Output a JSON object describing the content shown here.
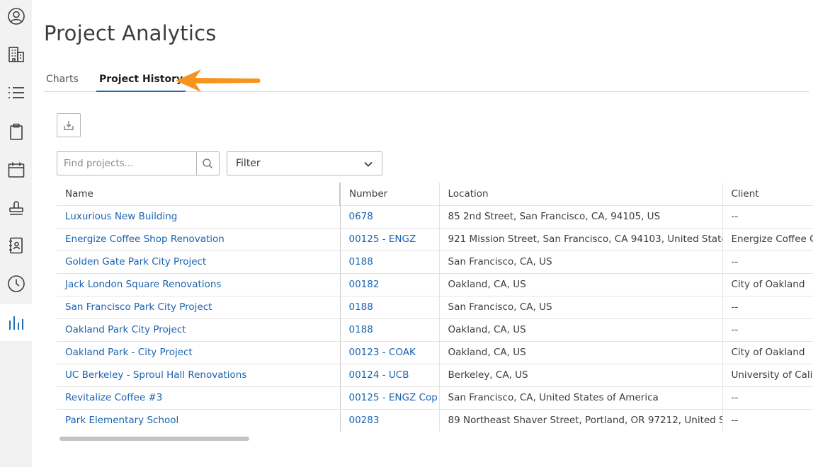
{
  "sidebar": {
    "items": [
      {
        "icon": "user-circle-icon"
      },
      {
        "icon": "building-icon"
      },
      {
        "icon": "list-icon"
      },
      {
        "icon": "clipboard-icon"
      },
      {
        "icon": "calendar-icon"
      },
      {
        "icon": "stamp-icon"
      },
      {
        "icon": "address-book-icon"
      },
      {
        "icon": "clock-icon"
      },
      {
        "icon": "analytics-icon",
        "active": true
      }
    ],
    "accent": "#1f6fb5"
  },
  "page": {
    "title": "Project Analytics"
  },
  "tabs": [
    {
      "label": "Charts",
      "active": false
    },
    {
      "label": "Project History",
      "active": true
    }
  ],
  "annotation": {
    "arrow_color": "#f7941d"
  },
  "toolbar": {
    "export_icon": "export-icon"
  },
  "search": {
    "placeholder": "Find projects...",
    "value": ""
  },
  "filter": {
    "label": "Filter"
  },
  "table": {
    "columns": [
      "Name",
      "Number",
      "Location",
      "Client"
    ],
    "rows": [
      {
        "name": "Luxurious New Building",
        "number": "0678",
        "location": "85 2nd Street, San Francisco, CA, 94105, US",
        "client": "--"
      },
      {
        "name": "Energize Coffee Shop Renovation",
        "number": "00125 - ENGZ",
        "location": "921 Mission Street, San Francisco, CA 94103, United State",
        "client": "Energize Coffee Co"
      },
      {
        "name": "Golden Gate Park City Project",
        "number": "0188",
        "location": "San Francisco, CA, US",
        "client": "--"
      },
      {
        "name": "Jack London Square Renovations",
        "number": "00182",
        "location": "Oakland, CA, US",
        "client": "City of Oakland"
      },
      {
        "name": "San Francisco Park City Project",
        "number": "0188",
        "location": "San Francisco, CA, US",
        "client": "--"
      },
      {
        "name": "Oakland Park City Project",
        "number": "0188",
        "location": "Oakland, CA, US",
        "client": "--"
      },
      {
        "name": "Oakland Park - City Project",
        "number": "00123 - COAK",
        "location": "Oakland, CA, US",
        "client": "City of Oakland"
      },
      {
        "name": "UC Berkeley - Sproul Hall Renovations",
        "number": "00124 - UCB",
        "location": "Berkeley, CA, US",
        "client": "University of Calif"
      },
      {
        "name": "Revitalize Coffee #3",
        "number": "00125 - ENGZ Cop",
        "location": "San Francisco, CA, United States of America",
        "client": "--"
      },
      {
        "name": "Park Elementary School",
        "number": "00283",
        "location": "89 Northeast Shaver Street, Portland, OR 97212, United S",
        "client": "--"
      }
    ]
  },
  "colors": {
    "link": "#1a63b0",
    "text": "#3c3c3c"
  }
}
